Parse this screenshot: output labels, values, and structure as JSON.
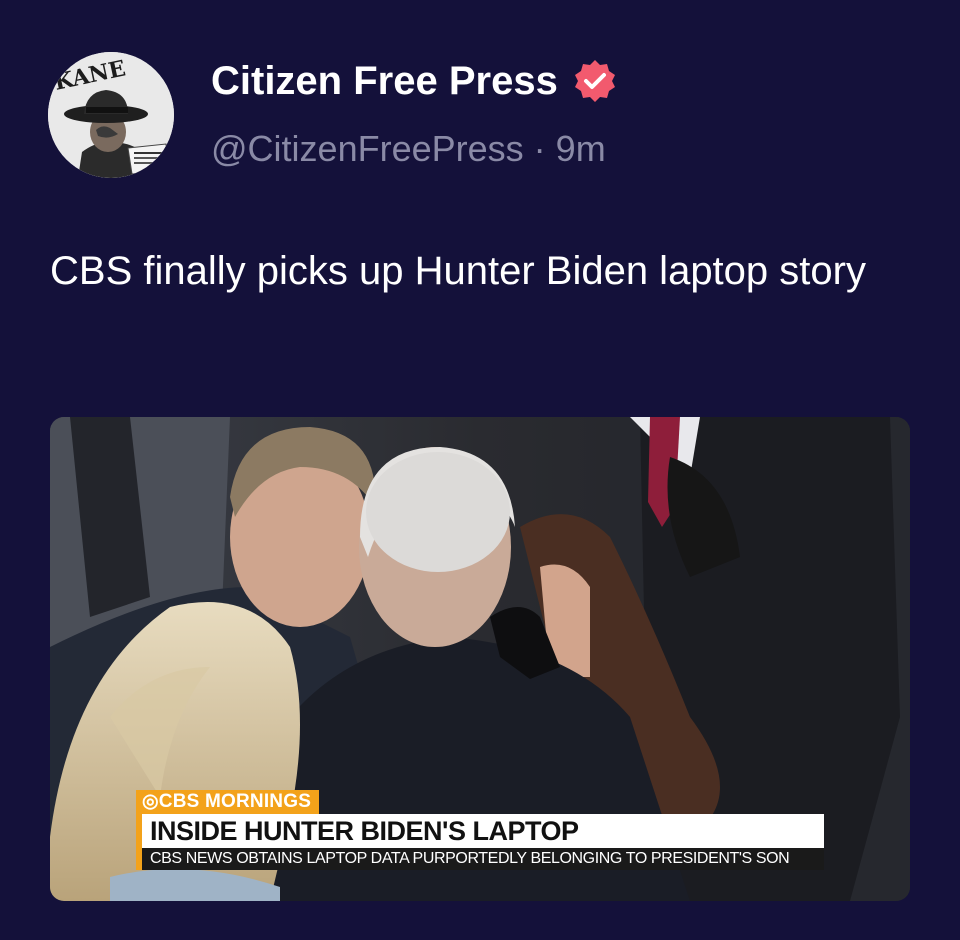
{
  "post": {
    "author_name": "Citizen Free Press",
    "handle": "@CitizenFreePress",
    "separator": "·",
    "time_ago": "9m",
    "text": "CBS finally picks up Hunter Biden laptop story",
    "avatar_text": "KANE",
    "verified_badge_color": "#f25a6e"
  },
  "media": {
    "brand": "CBS MORNINGS",
    "headline": "INSIDE HUNTER BIDEN'S LAPTOP",
    "subline": "CBS NEWS OBTAINS LAPTOP DATA PURPORTEDLY BELONGING TO PRESIDENT'S SON",
    "accent_color": "#f3a21a"
  },
  "colors": {
    "background": "#14113a",
    "handle_text": "#8a8aa6"
  }
}
